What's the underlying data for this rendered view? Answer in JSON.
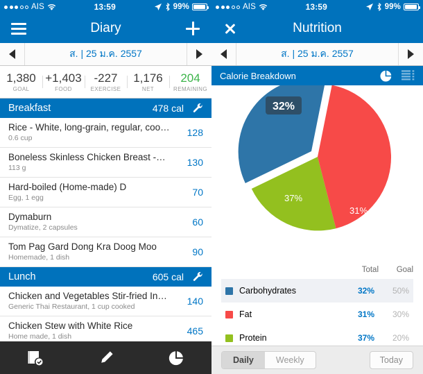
{
  "status_bar": {
    "carrier": "AIS",
    "signal_dots_filled": 3,
    "signal_dots_total": 5,
    "wifi_icon": "wifi-icon",
    "time": "13:59",
    "location_icon": "location-arrow-icon",
    "bluetooth_icon": "bluetooth-icon",
    "battery_percent": "99%"
  },
  "diary": {
    "nav": {
      "menu_icon": "hamburger-menu-icon",
      "title": "Diary",
      "add_icon": "plus-icon"
    },
    "date": {
      "prev_icon": "triangle-left-icon",
      "label": "ส. | 25 ม.ค. 2557",
      "next_icon": "triangle-right-icon"
    },
    "summary": [
      {
        "value": "1,380",
        "label": "GOAL",
        "color": "#3c3c3c"
      },
      {
        "value": "+1,403",
        "label": "FOOD",
        "color": "#3c3c3c"
      },
      {
        "value": "-227",
        "label": "EXERCISE",
        "color": "#3c3c3c"
      },
      {
        "value": "1,176",
        "label": "NET",
        "color": "#3c3c3c"
      },
      {
        "value": "204",
        "label": "REMAINING",
        "color": "#3CB44A"
      }
    ],
    "meals": [
      {
        "name": "Breakfast",
        "calories": "478 cal",
        "settings_icon": "wrench-icon",
        "items": [
          {
            "name": "Rice - White, long-grain, regular, coo…",
            "detail": "0.6 cup",
            "calories": "128"
          },
          {
            "name": "Boneless Skinless Chicken Breast -…",
            "detail": "113 g",
            "calories": "130"
          },
          {
            "name": "Hard-boiled (Home-made) D",
            "detail": "Egg, 1 egg",
            "calories": "70"
          },
          {
            "name": "Dymaburn",
            "detail": "Dymatize, 2 capsules",
            "calories": "60"
          },
          {
            "name": "Tom Pag Gard Dong Kra Doog Moo",
            "detail": "Homemade, 1 dish",
            "calories": "90"
          }
        ]
      },
      {
        "name": "Lunch",
        "calories": "605 cal",
        "settings_icon": "wrench-icon",
        "items": [
          {
            "name": "Chicken and Vegetables Stir-fried In…",
            "detail": "Generic Thai Restaurant, 1 cup cooked",
            "calories": "140"
          },
          {
            "name": "Chicken Stew with White Rice",
            "detail": "Home made, 1 dish",
            "calories": "465"
          }
        ]
      }
    ],
    "tabbar": [
      {
        "icon": "diary-check-icon",
        "name": "tab-diary"
      },
      {
        "icon": "pencil-icon",
        "name": "tab-edit"
      },
      {
        "icon": "pie-chart-icon",
        "name": "tab-nutrition"
      }
    ]
  },
  "nutrition": {
    "nav": {
      "close_icon": "close-x-icon",
      "title": "Nutrition"
    },
    "date": {
      "prev_icon": "triangle-left-icon",
      "label": "ส. | 25 ม.ค. 2557",
      "next_icon": "triangle-right-icon"
    },
    "section": {
      "title": "Calorie Breakdown",
      "pie_icon": "pie-chart-icon",
      "list_icon": "list-view-icon"
    },
    "table": {
      "headers": {
        "name": "",
        "total": "Total",
        "goal": "Goal"
      },
      "rows": [
        {
          "label": "Carbohydrates",
          "color": "#2E75A8",
          "total": "32%",
          "goal": "50%",
          "highlighted": true
        },
        {
          "label": "Fat",
          "color": "#F74A48",
          "total": "31%",
          "goal": "30%",
          "highlighted": false
        },
        {
          "label": "Protein",
          "color": "#93C01F",
          "total": "37%",
          "goal": "20%",
          "highlighted": false
        }
      ]
    },
    "footer": {
      "segments": [
        {
          "label": "Daily",
          "active": true
        },
        {
          "label": "Weekly",
          "active": false
        }
      ],
      "today_label": "Today"
    }
  },
  "chart_data": {
    "type": "pie",
    "title": "Calorie Breakdown",
    "labels": [
      "Carbohydrates",
      "Fat",
      "Protein"
    ],
    "values": [
      32,
      31,
      37
    ],
    "value_labels": [
      "32%",
      "31%",
      "37%"
    ],
    "goals": [
      50,
      30,
      20
    ],
    "goal_labels": [
      "50%",
      "30%",
      "20%"
    ],
    "colors": [
      "#2E75A8",
      "#F74A48",
      "#93C01F"
    ],
    "exploded_slice": "Carbohydrates",
    "selected_slice_label": "32%",
    "legend_position": "below",
    "grid": false
  }
}
